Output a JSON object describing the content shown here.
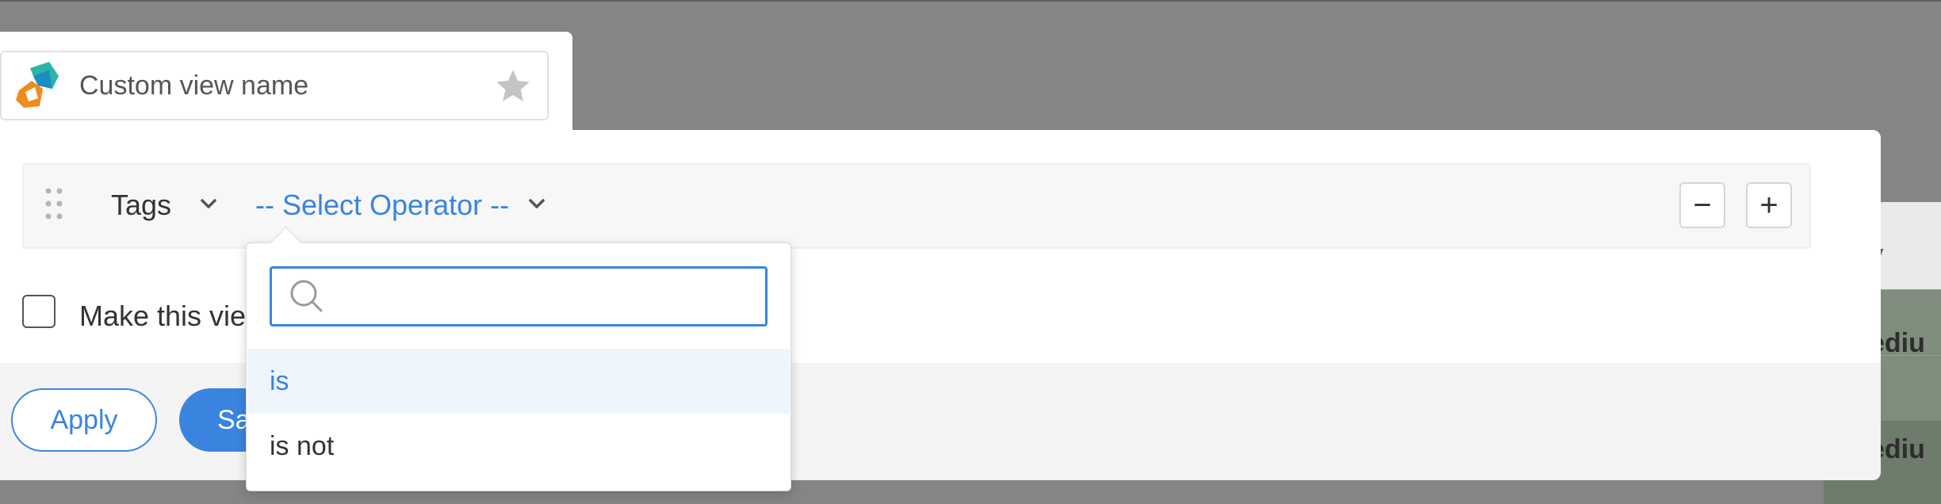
{
  "view": {
    "name_placeholder": "Custom view name"
  },
  "criteria": {
    "field": "Tags",
    "operator": "-- Select Operator --",
    "remove_label": "−",
    "add_label": "+"
  },
  "options": {
    "checkbox_label": "Make this vie",
    "apply_label": "Apply",
    "save_label": "Sa"
  },
  "operator_dropdown": {
    "search_value": "",
    "items": [
      {
        "label": "is",
        "selected": true
      },
      {
        "label": "is not",
        "selected": false
      }
    ]
  },
  "background_table": {
    "header_partial": "rity",
    "rows_partial": [
      "ediu",
      "ediu"
    ]
  },
  "colors": {
    "accent": "#3a84e0",
    "overlay": "#858585"
  }
}
